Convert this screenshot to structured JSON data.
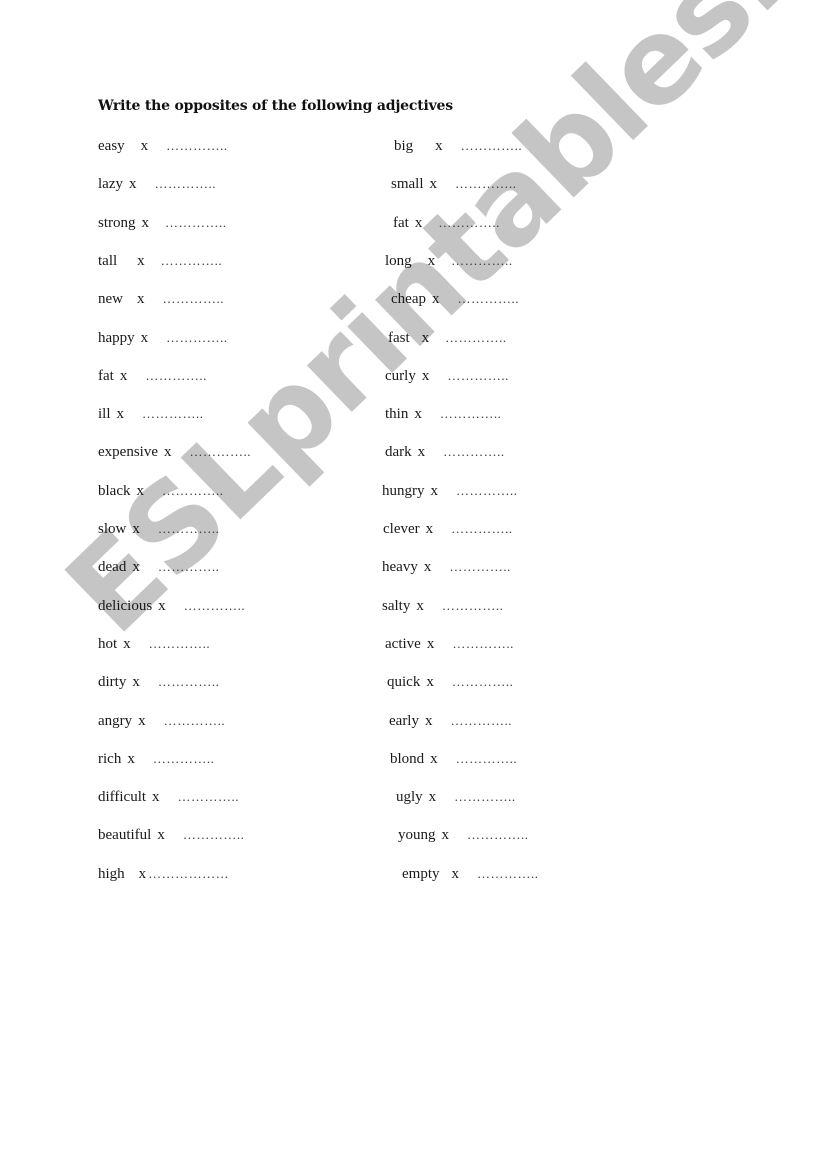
{
  "title": "Write the opposites of the following adjectives",
  "separator": "x",
  "blank": "…………..",
  "left_column": [
    {
      "word": "easy"
    },
    {
      "word": "lazy"
    },
    {
      "word": "strong"
    },
    {
      "word": "tall"
    },
    {
      "word": "new"
    },
    {
      "word": "happy"
    },
    {
      "word": "fat"
    },
    {
      "word": "ill"
    },
    {
      "word": "expensive"
    },
    {
      "word": "black"
    },
    {
      "word": "slow"
    },
    {
      "word": "dead"
    },
    {
      "word": "delicious"
    },
    {
      "word": "hot"
    },
    {
      "word": "dirty"
    },
    {
      "word": "angry"
    },
    {
      "word": "rich"
    },
    {
      "word": "difficult"
    },
    {
      "word": "beautiful"
    },
    {
      "word": "high"
    }
  ],
  "right_column": [
    {
      "word": "big"
    },
    {
      "word": "small"
    },
    {
      "word": "fat"
    },
    {
      "word": "long"
    },
    {
      "word": "cheap"
    },
    {
      "word": "fast"
    },
    {
      "word": "curly"
    },
    {
      "word": "thin"
    },
    {
      "word": "dark"
    },
    {
      "word": "hungry"
    },
    {
      "word": "clever"
    },
    {
      "word": "heavy"
    },
    {
      "word": "salty"
    },
    {
      "word": "active"
    },
    {
      "word": "quick"
    },
    {
      "word": "early"
    },
    {
      "word": "blond"
    },
    {
      "word": "ugly"
    },
    {
      "word": "young"
    },
    {
      "word": "empty"
    }
  ],
  "last_left_blank": "………………",
  "watermark": "ESLprintables.com"
}
